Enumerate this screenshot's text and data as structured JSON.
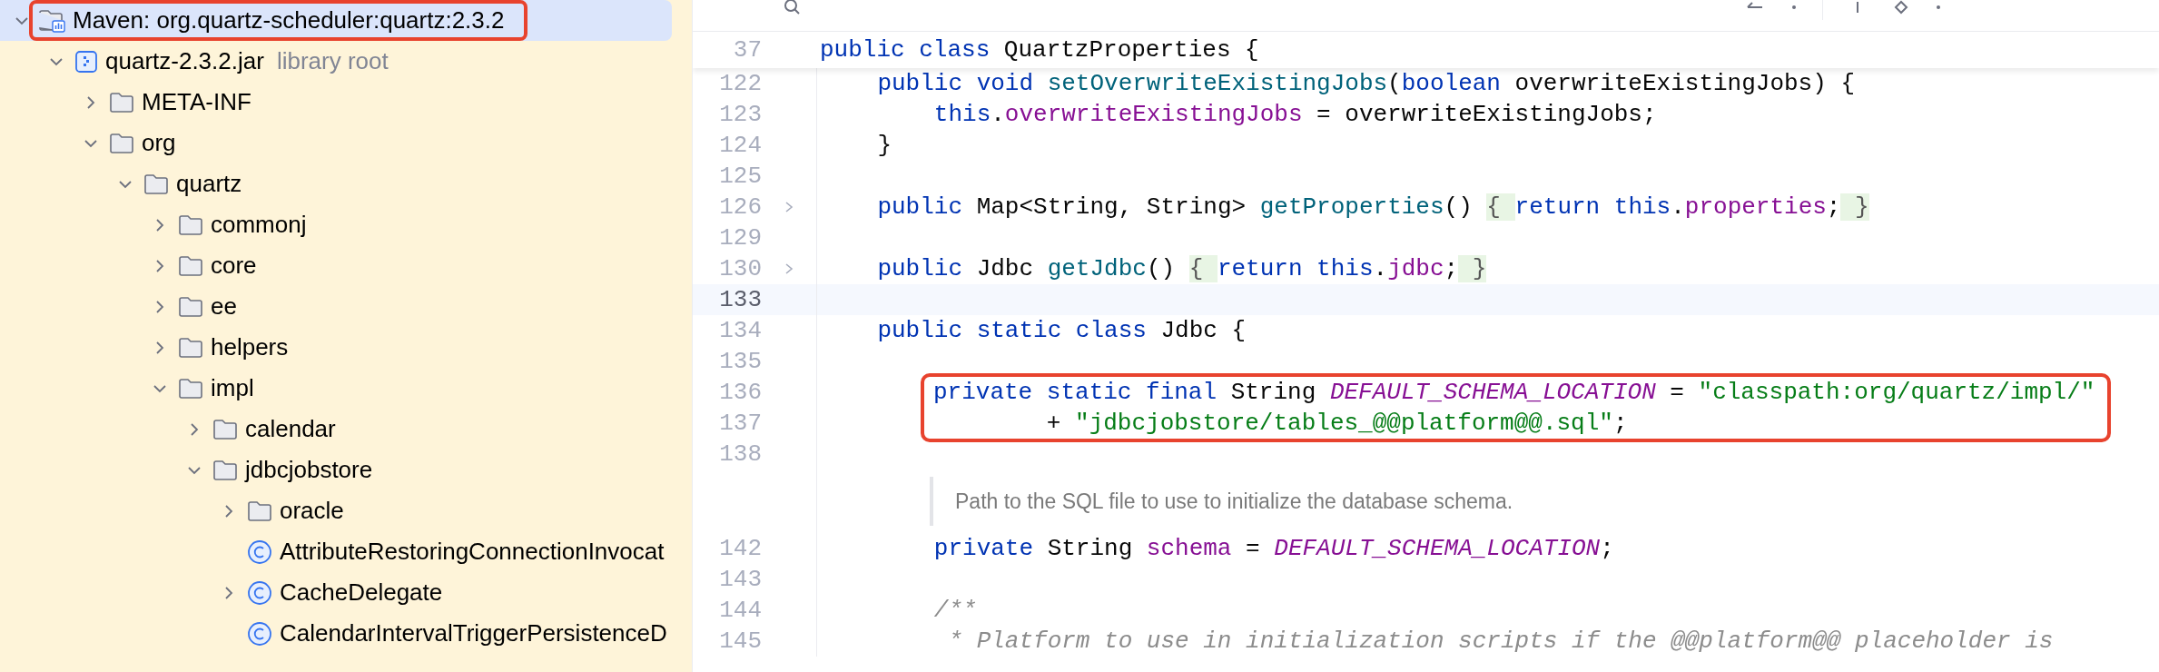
{
  "tree": [
    {
      "label": "Maven: org.quartz-scheduler:quartz:2.3.2",
      "kind": "library",
      "expanded": true,
      "selected": true,
      "annotated": true,
      "children": [
        {
          "label": "quartz-2.3.2.jar",
          "hint": "library root",
          "kind": "jar",
          "expanded": true,
          "selected": false,
          "annotated": false,
          "children": [
            {
              "label": "META-INF",
              "kind": "folder",
              "expanded": false,
              "selected": false,
              "annotated": false
            },
            {
              "label": "org",
              "kind": "folder",
              "expanded": true,
              "selected": false,
              "annotated": false,
              "children": [
                {
                  "label": "quartz",
                  "kind": "folder",
                  "expanded": true,
                  "selected": false,
                  "annotated": false,
                  "children": [
                    {
                      "label": "commonj",
                      "kind": "folder",
                      "expanded": false,
                      "selected": false,
                      "annotated": false
                    },
                    {
                      "label": "core",
                      "kind": "folder",
                      "expanded": false,
                      "selected": false,
                      "annotated": false
                    },
                    {
                      "label": "ee",
                      "kind": "folder",
                      "expanded": false,
                      "selected": false,
                      "annotated": false
                    },
                    {
                      "label": "helpers",
                      "kind": "folder",
                      "expanded": false,
                      "selected": false,
                      "annotated": false
                    },
                    {
                      "label": "impl",
                      "kind": "folder",
                      "expanded": true,
                      "selected": false,
                      "annotated": false,
                      "children": [
                        {
                          "label": "calendar",
                          "kind": "folder",
                          "expanded": false,
                          "selected": false,
                          "annotated": false
                        },
                        {
                          "label": "jdbcjobstore",
                          "kind": "folder",
                          "expanded": true,
                          "selected": false,
                          "annotated": false,
                          "children": [
                            {
                              "label": "oracle",
                              "kind": "folder",
                              "expanded": false,
                              "selected": false,
                              "annotated": false
                            },
                            {
                              "label": "AttributeRestoringConnectionInvocat",
                              "kind": "class",
                              "selected": false,
                              "annotated": false
                            },
                            {
                              "label": "CacheDelegate",
                              "kind": "class",
                              "expanded": false,
                              "selected": false,
                              "annotated": false
                            },
                            {
                              "label": "CalendarIntervalTriggerPersistenceD",
                              "kind": "class",
                              "selected": false,
                              "annotated": false
                            }
                          ]
                        }
                      ]
                    }
                  ]
                }
              ]
            }
          ]
        }
      ]
    }
  ],
  "editor": {
    "header": {
      "number": "37",
      "tokens": [
        {
          "kind": "kw",
          "text": "public class "
        },
        {
          "kind": "tx",
          "text": "QuartzProperties {"
        }
      ]
    },
    "lines": [
      {
        "kind": "line",
        "number": "122",
        "folded": false,
        "current": false,
        "tokens": [
          {
            "kind": "kw",
            "text": "    public void "
          },
          {
            "kind": "fn",
            "text": "setOverwriteExistingJobs"
          },
          {
            "kind": "tx",
            "text": "("
          },
          {
            "kind": "kw",
            "text": "boolean "
          },
          {
            "kind": "tx",
            "text": "overwriteExistingJobs) {"
          }
        ]
      },
      {
        "kind": "line",
        "number": "123",
        "folded": false,
        "current": false,
        "tokens": [
          {
            "kind": "kw",
            "text": "        this"
          },
          {
            "kind": "tx",
            "text": "."
          },
          {
            "kind": "fld",
            "text": "overwriteExistingJobs"
          },
          {
            "kind": "tx",
            "text": " = overwriteExistingJobs;"
          }
        ]
      },
      {
        "kind": "line",
        "number": "124",
        "folded": false,
        "current": false,
        "tokens": [
          {
            "kind": "tx",
            "text": "    }"
          }
        ]
      },
      {
        "kind": "line",
        "number": "125",
        "folded": false,
        "current": false
      },
      {
        "kind": "line",
        "number": "126",
        "folded": true,
        "current": false,
        "tokens": [
          {
            "kind": "kw",
            "text": "    public "
          },
          {
            "kind": "tx",
            "text": "Map<String, String> "
          },
          {
            "kind": "fn",
            "text": "getProperties"
          },
          {
            "kind": "tx",
            "text": "() "
          },
          {
            "kind": "fold",
            "text": "{ "
          },
          {
            "kind": "kw",
            "text": "return this"
          },
          {
            "kind": "tx",
            "text": "."
          },
          {
            "kind": "fld",
            "text": "properties"
          },
          {
            "kind": "tx",
            "text": ";"
          },
          {
            "kind": "fold",
            "text": " }"
          }
        ]
      },
      {
        "kind": "line",
        "number": "129",
        "folded": false,
        "current": false
      },
      {
        "kind": "line",
        "number": "130",
        "folded": true,
        "current": false,
        "tokens": [
          {
            "kind": "kw",
            "text": "    public "
          },
          {
            "kind": "tx",
            "text": "Jdbc "
          },
          {
            "kind": "fn",
            "text": "getJdbc"
          },
          {
            "kind": "tx",
            "text": "() "
          },
          {
            "kind": "fold",
            "text": "{ "
          },
          {
            "kind": "kw",
            "text": "return this"
          },
          {
            "kind": "tx",
            "text": "."
          },
          {
            "kind": "fld",
            "text": "jdbc"
          },
          {
            "kind": "tx",
            "text": ";"
          },
          {
            "kind": "fold",
            "text": " }"
          }
        ]
      },
      {
        "kind": "line",
        "number": "133",
        "folded": false,
        "current": true
      },
      {
        "kind": "line",
        "number": "134",
        "folded": false,
        "current": false,
        "tokens": [
          {
            "kind": "kw",
            "text": "    public static class "
          },
          {
            "kind": "tx",
            "text": "Jdbc {"
          }
        ]
      },
      {
        "kind": "line",
        "number": "135",
        "folded": false,
        "current": false
      },
      {
        "kind": "boxed",
        "lines": [
          {
            "number": "136",
            "tokens": [
              {
                "kind": "kw",
                "text": "private static final "
              },
              {
                "kind": "tx",
                "text": "String "
              },
              {
                "kind": "const",
                "text": "DEFAULT_SCHEMA_LOCATION"
              },
              {
                "kind": "tx",
                "text": " = "
              },
              {
                "kind": "str",
                "text": "\"classpath:org/quartz/impl/\""
              }
            ]
          },
          {
            "number": "137",
            "tokens": [
              {
                "kind": "tx",
                "text": "        + "
              },
              {
                "kind": "str",
                "text": "\"jdbcjobstore/tables_@@platform@@.sql\""
              },
              {
                "kind": "tx",
                "text": ";"
              }
            ]
          }
        ]
      },
      {
        "kind": "line",
        "number": "138",
        "folded": false,
        "current": false
      },
      {
        "kind": "doc",
        "text": "Path to the SQL file to use to initialize the database schema."
      },
      {
        "kind": "line",
        "number": "142",
        "folded": false,
        "current": false,
        "tokens": [
          {
            "kind": "kw",
            "text": "        private "
          },
          {
            "kind": "tx",
            "text": "String "
          },
          {
            "kind": "fld",
            "text": "schema"
          },
          {
            "kind": "tx",
            "text": " = "
          },
          {
            "kind": "const",
            "text": "DEFAULT_SCHEMA_LOCATION"
          },
          {
            "kind": "tx",
            "text": ";"
          }
        ]
      },
      {
        "kind": "line",
        "number": "143",
        "folded": false,
        "current": false
      },
      {
        "kind": "line",
        "number": "144",
        "folded": false,
        "current": false,
        "tokens": [
          {
            "kind": "cm",
            "text": "        /**"
          }
        ]
      },
      {
        "kind": "line",
        "number": "145",
        "folded": false,
        "current": false,
        "tokens": [
          {
            "kind": "cm",
            "text": "         * Platform to use in initialization scripts if the @@platform@@ placeholder is"
          }
        ]
      }
    ]
  }
}
